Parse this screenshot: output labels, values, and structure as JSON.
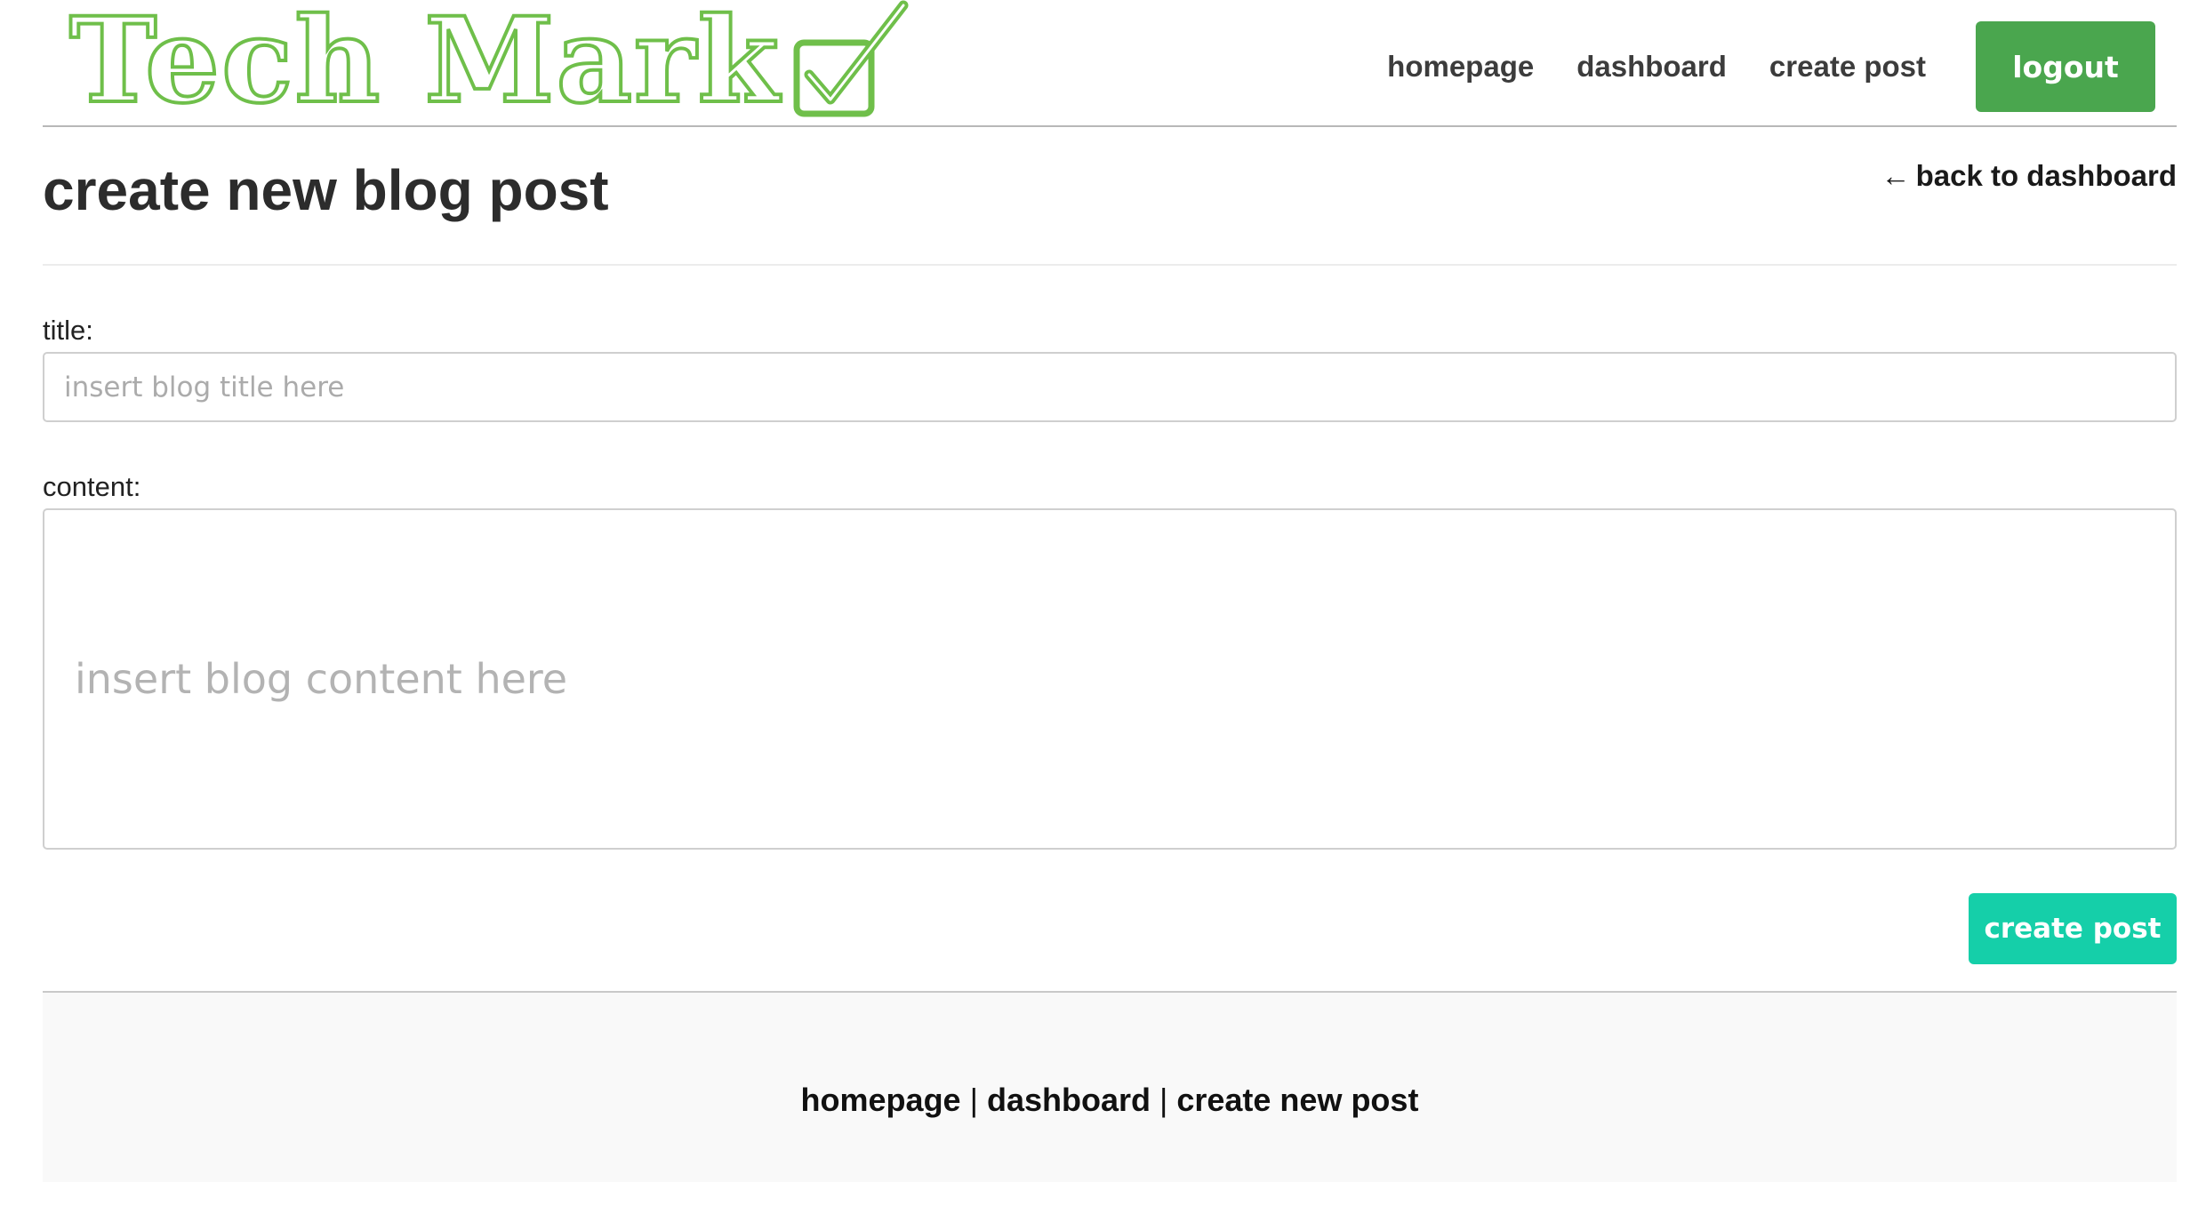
{
  "brand": {
    "logo_text": "Tech Mark",
    "accent_color": "#6fbf4a",
    "logo_icon": "checkbox-check-icon"
  },
  "nav": {
    "homepage": "homepage",
    "dashboard": "dashboard",
    "create_post": "create post",
    "logout": "logout",
    "logout_color": "#4aa64e"
  },
  "page": {
    "title": "create new blog post",
    "back_arrow": "←",
    "back_label": "back to dashboard"
  },
  "form": {
    "title_label": "title:",
    "title_placeholder": "insert blog title here",
    "title_value": "",
    "content_label": "content:",
    "content_placeholder": "insert blog content here",
    "content_value": "",
    "submit_label": "create post",
    "submit_color": "#15cfa9"
  },
  "footer": {
    "homepage": "homepage",
    "separator": "|",
    "dashboard": "dashboard",
    "create_new_post": "create new post"
  }
}
